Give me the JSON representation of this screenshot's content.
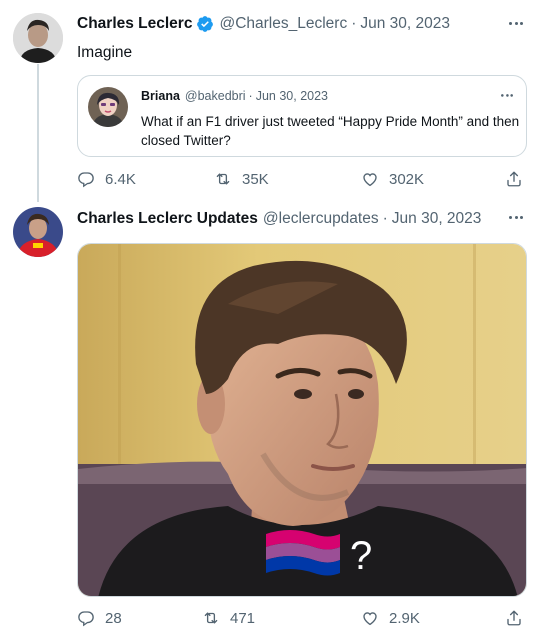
{
  "tweet1": {
    "display_name": "Charles Leclerc",
    "handle": "@Charles_Leclerc",
    "separator": "·",
    "date": "Jun 30, 2023",
    "text": "Imagine",
    "quote": {
      "display_name": "Briana",
      "handle": "@bakedbri",
      "separator": "·",
      "date": "Jun 30, 2023",
      "text": "What if an F1 driver just tweeted “Happy Pride Month” and then closed Twitter?"
    },
    "stats": {
      "replies": "6.4K",
      "retweets": "35K",
      "likes": "302K"
    }
  },
  "tweet2": {
    "display_name": "Charles Leclerc Updates",
    "handle": "@leclercupdates",
    "separator": "·",
    "date": "Jun 30, 2023",
    "media_overlay_text": "?",
    "stats": {
      "replies": "28",
      "retweets": "471",
      "likes": "2.9K"
    }
  },
  "colors": {
    "text": "#0f1419",
    "muted": "#536471",
    "verified": "#1d9bf0",
    "border": "#cfd9de",
    "flag_pink": "#d60270",
    "flag_purple": "#9b4f96",
    "flag_blue": "#0038a8"
  },
  "icons": [
    "verified-badge-icon",
    "more-icon",
    "reply-icon",
    "retweet-icon",
    "like-icon",
    "share-icon"
  ]
}
